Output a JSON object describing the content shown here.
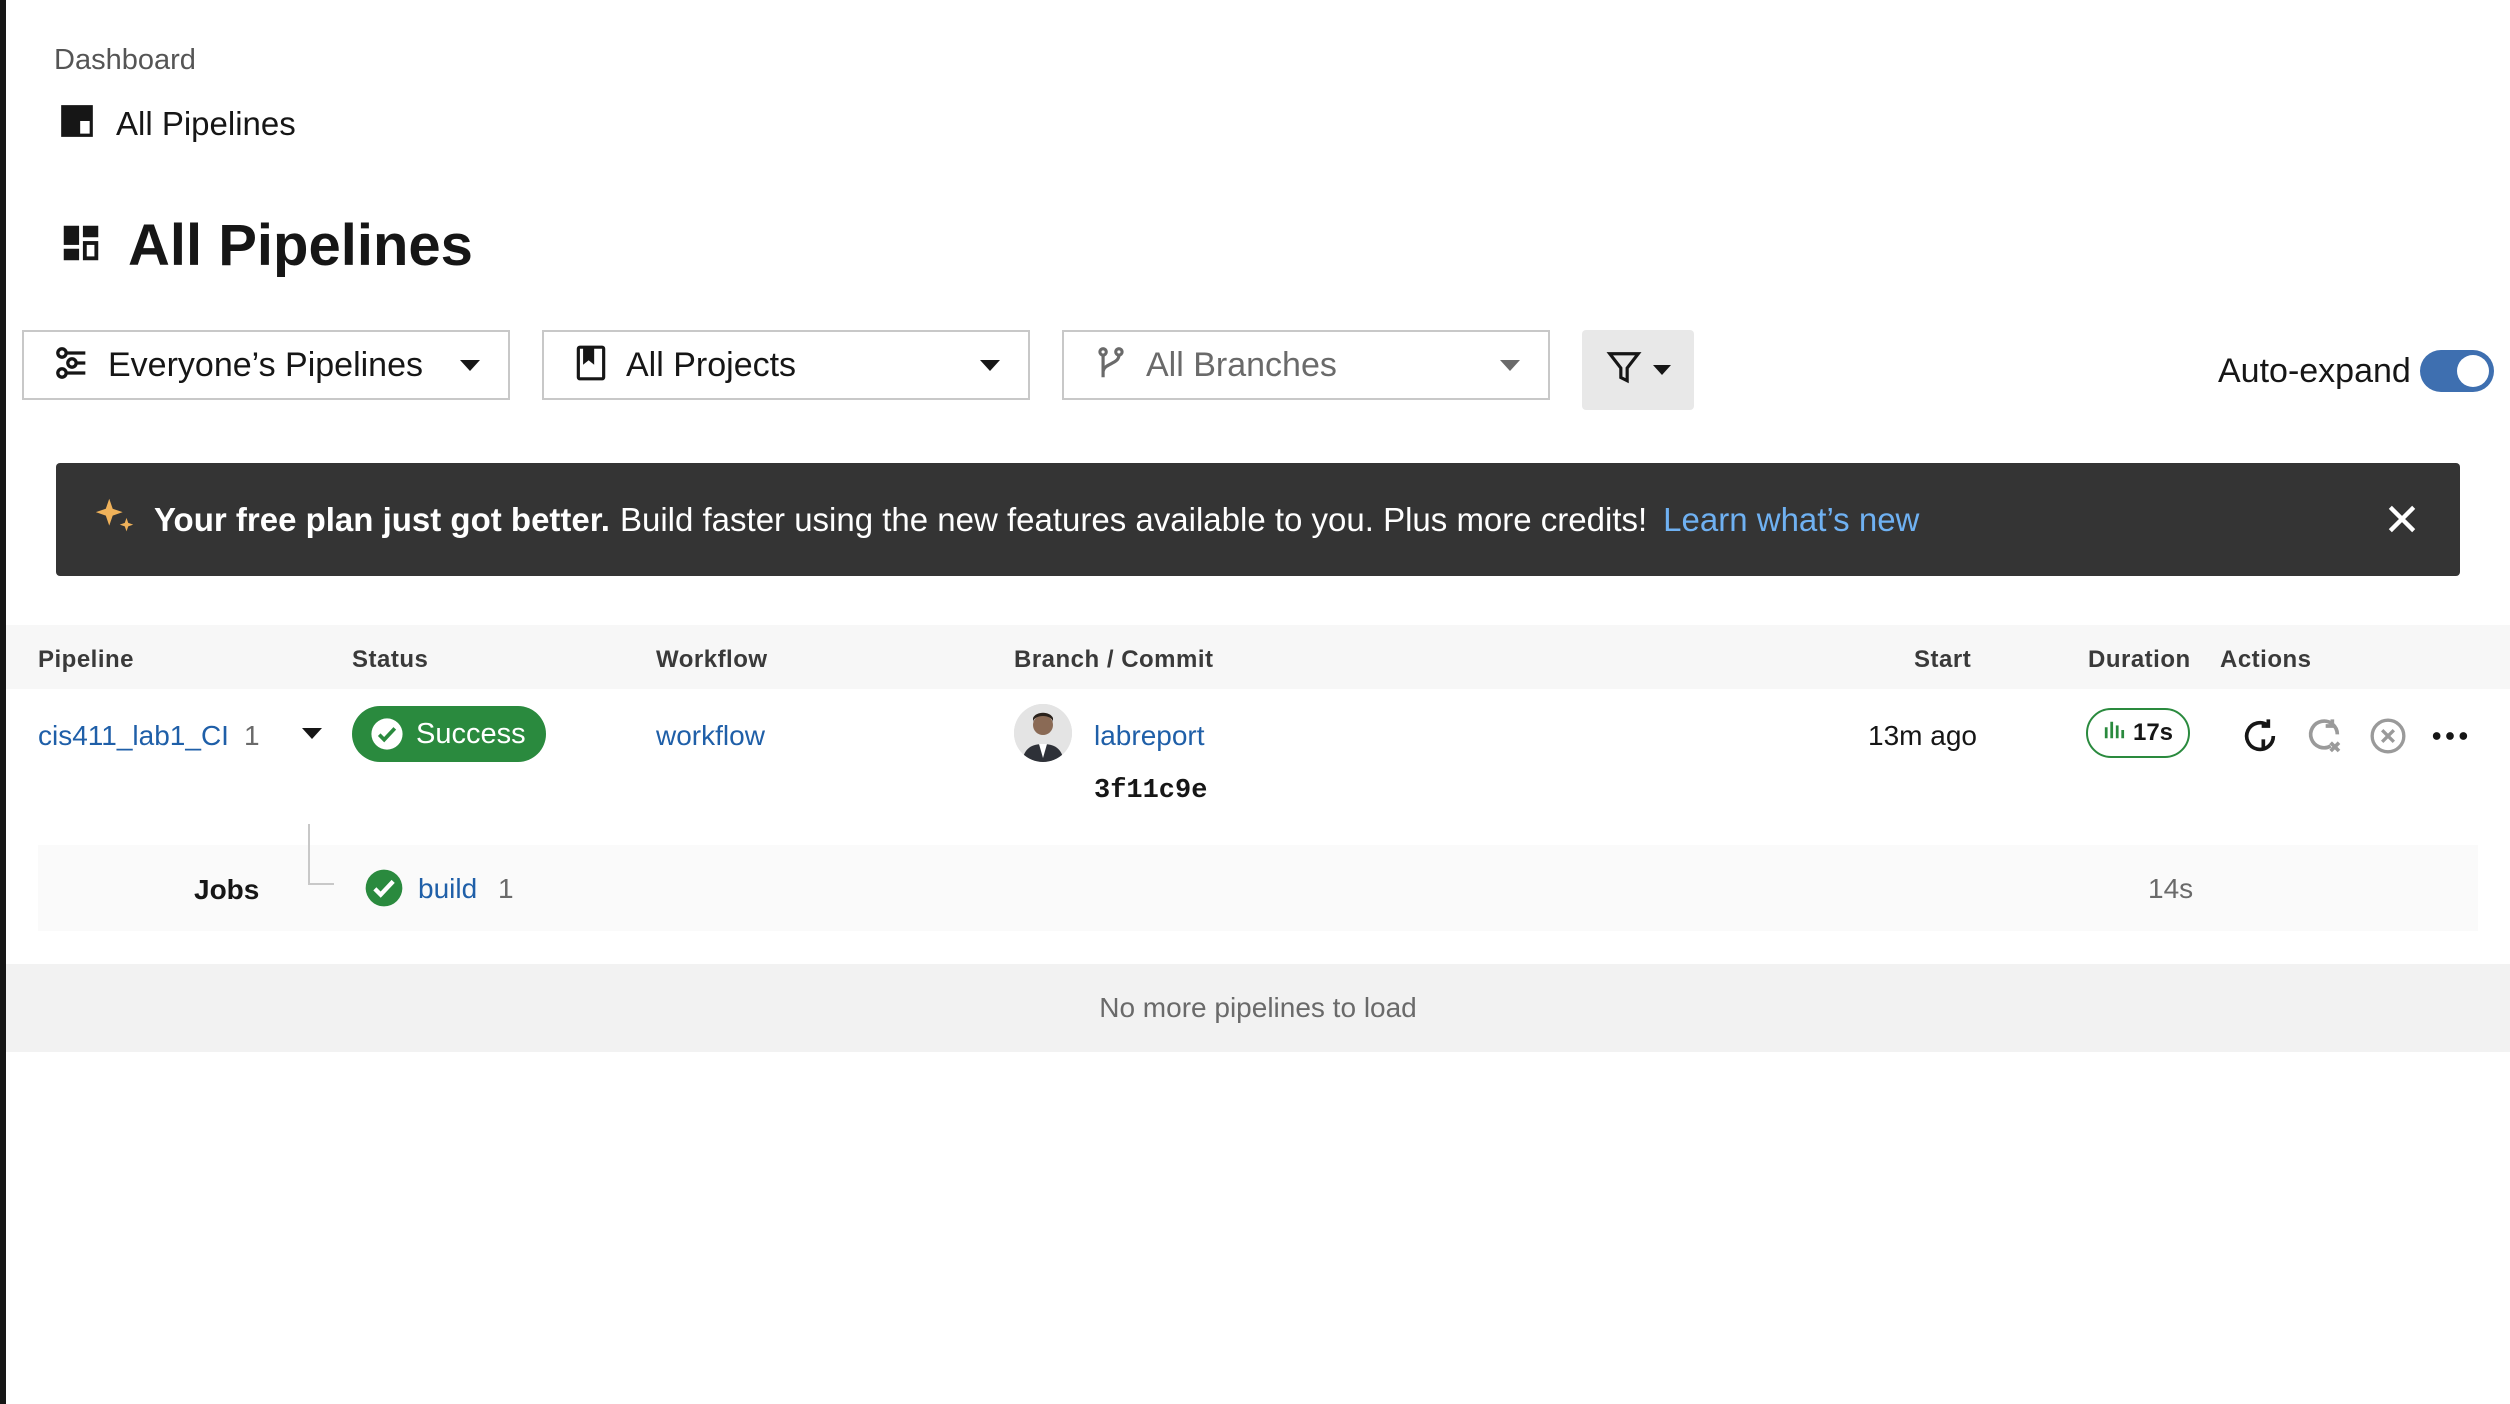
{
  "breadcrumb": {
    "dashboard": "Dashboard",
    "current": "All Pipelines"
  },
  "page_title": "All Pipelines",
  "filters": {
    "pipelines": "Everyone’s Pipelines",
    "projects": "All Projects",
    "branches": "All Branches",
    "auto_expand_label": "Auto-expand",
    "auto_expand_on": true
  },
  "banner": {
    "bold": "Your free plan just got better.",
    "text": "Build faster using the new features available to you. Plus more credits!",
    "link": "Learn what’s new"
  },
  "table": {
    "headers": [
      "Pipeline",
      "Status",
      "Workflow",
      "Branch / Commit",
      "Start",
      "Duration",
      "Actions"
    ],
    "row": {
      "pipeline": "cis411_lab1_CI",
      "number": "1",
      "status": "Success",
      "workflow": "workflow",
      "branch": "labreport",
      "commit": "3f11c9e",
      "start": "13m ago",
      "duration": "17s"
    },
    "jobs": {
      "label": "Jobs",
      "job_name": "build",
      "job_number": "1",
      "job_duration": "14s"
    },
    "footer": "No more pipelines to load"
  },
  "colors": {
    "success": "#2a8a3e",
    "link": "#1f5fa8",
    "banner_bg": "#343434",
    "banner_link": "#6fb1f2",
    "toggle": "#3e6fb0"
  }
}
